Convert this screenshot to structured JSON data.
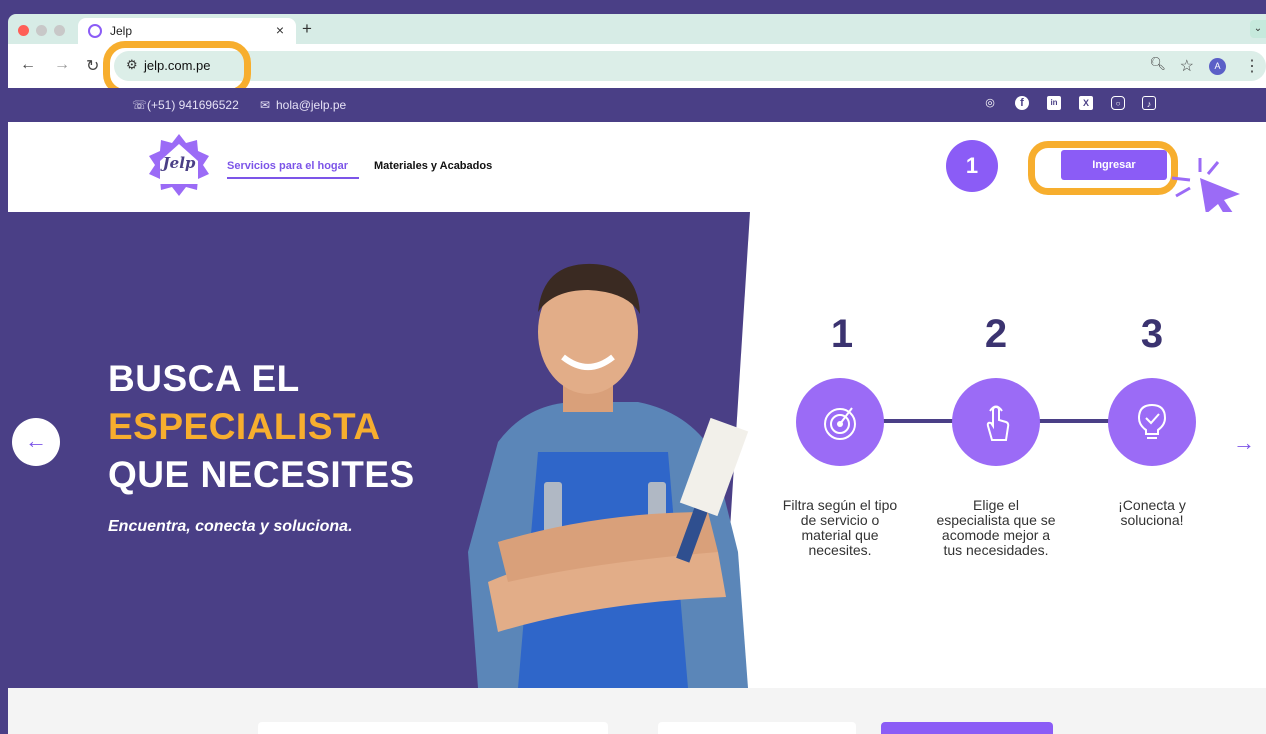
{
  "browser": {
    "tab_title": "Jelp",
    "tab_close": "×",
    "new_tab": "+",
    "url": "jelp.com.pe",
    "profile_initial": "A"
  },
  "contact": {
    "phone": "(+51) 941696522",
    "email": "hola@jelp.pe",
    "socials": [
      "whatsapp-icon",
      "facebook-icon",
      "linkedin-icon",
      "x-icon",
      "instagram-icon",
      "tiktok-icon"
    ]
  },
  "nav": {
    "logo": "Jelp",
    "active": "Servicios para el hogar",
    "other": "Materiales y Acabados",
    "login": "Ingresar"
  },
  "annotation": {
    "step": "1"
  },
  "hero": {
    "line1": "BUSCA EL",
    "line2": "ESPECIALISTA",
    "line3": "QUE NECESITES",
    "tagline": "Encuentra, conecta y soluciona.",
    "steps": [
      {
        "num": "1",
        "text": "Filtra según el tipo de servicio o material que necesites."
      },
      {
        "num": "2",
        "text": "Elige el especialista que se acomode mejor a tus necesidades."
      },
      {
        "num": "3",
        "text": "¡Conecta y soluciona!"
      }
    ]
  },
  "colors": {
    "brand_purple": "#4a3f86",
    "accent_purple": "#8b5cf6",
    "highlight_orange": "#f7ae2e"
  }
}
